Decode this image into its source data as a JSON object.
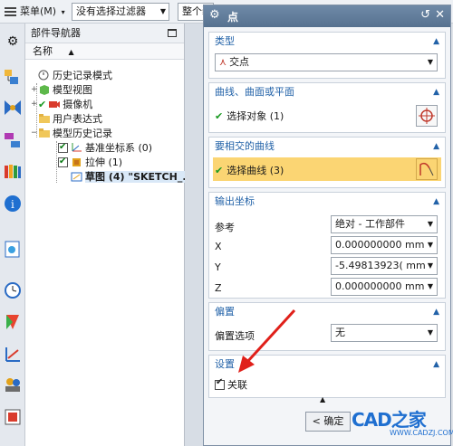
{
  "topbar": {
    "menu_label": "菜单(M)",
    "filter_value": "没有选择过滤器",
    "scope_value": "整个装"
  },
  "navigator": {
    "title": "部件导航器",
    "column_name": "名称",
    "items": [
      {
        "label": "历史记录模式"
      },
      {
        "label": "模型视图"
      },
      {
        "label": "摄像机"
      },
      {
        "label": "用户表达式"
      },
      {
        "label": "模型历史记录"
      },
      {
        "label": "基准坐标系 (0)"
      },
      {
        "label": "拉伸 (1)"
      },
      {
        "label": "草图 (4) \"SKETCH_..."
      }
    ]
  },
  "dialog": {
    "title": "点",
    "type_group": {
      "header": "类型",
      "value": "交点"
    },
    "curve_group": {
      "header": "曲线、曲面或平面",
      "label": "选择对象 (1)"
    },
    "intersect_group": {
      "header": "要相交的曲线",
      "label": "选择曲线 (3)"
    },
    "output_group": {
      "header": "输出坐标",
      "ref_label": "参考",
      "ref_value": "绝对 - 工作部件",
      "x_label": "X",
      "x_value": "0.000000000",
      "x_unit": "mm",
      "y_label": "Y",
      "y_value": "-5.49813923(",
      "y_unit": "mm",
      "z_label": "Z",
      "z_value": "0.000000000",
      "z_unit": "mm"
    },
    "offset_group": {
      "header": "偏置",
      "label": "偏置选项",
      "value": "无"
    },
    "settings_group": {
      "header": "设置",
      "assoc_label": "关联"
    },
    "ok_label": "< 确定",
    "watermark": "CAD之家",
    "watermark_url": "WWW.CADZJ.COM"
  },
  "colors": {
    "accent": "#2262a8",
    "highlight": "#fbd573",
    "title_bar": "#56718f",
    "arrow": "#e0201a"
  }
}
